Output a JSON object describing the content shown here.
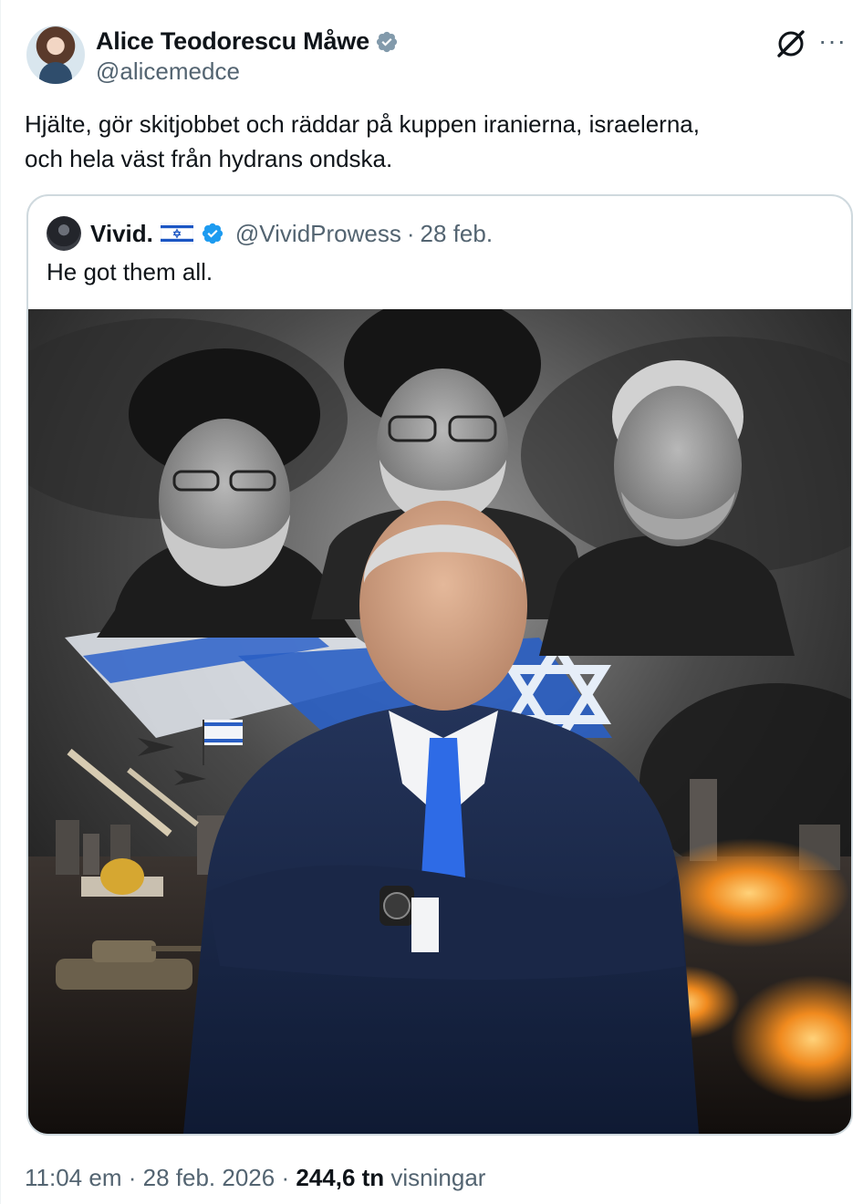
{
  "author": {
    "display_name": "Alice Teodorescu Måwe",
    "handle": "@alicemedce",
    "verified": true
  },
  "actions": {
    "grok_icon": "grok-icon",
    "more_label": "···"
  },
  "tweet": {
    "text_line1": "Hjälte, gör skitjobbet och räddar på kuppen iranierna, israelerna,",
    "text_line2": "och hela väst från hydrans ondska."
  },
  "quote": {
    "display_name": "Vivid.",
    "flag_icon": "israel-flag-icon",
    "verified": true,
    "handle": "@VividProwess",
    "separator": "·",
    "date": "28 feb.",
    "text": "He got them all."
  },
  "meta": {
    "time": "11:04 em",
    "separator1": "·",
    "date": "28 feb. 2026",
    "separator2": "·",
    "views_count": "244,6 tn",
    "views_label": "visningar"
  },
  "colors": {
    "text_primary": "#0f1419",
    "text_secondary": "#536471",
    "verified_blue": "#1d9bf0",
    "border": "#cfd9de"
  }
}
